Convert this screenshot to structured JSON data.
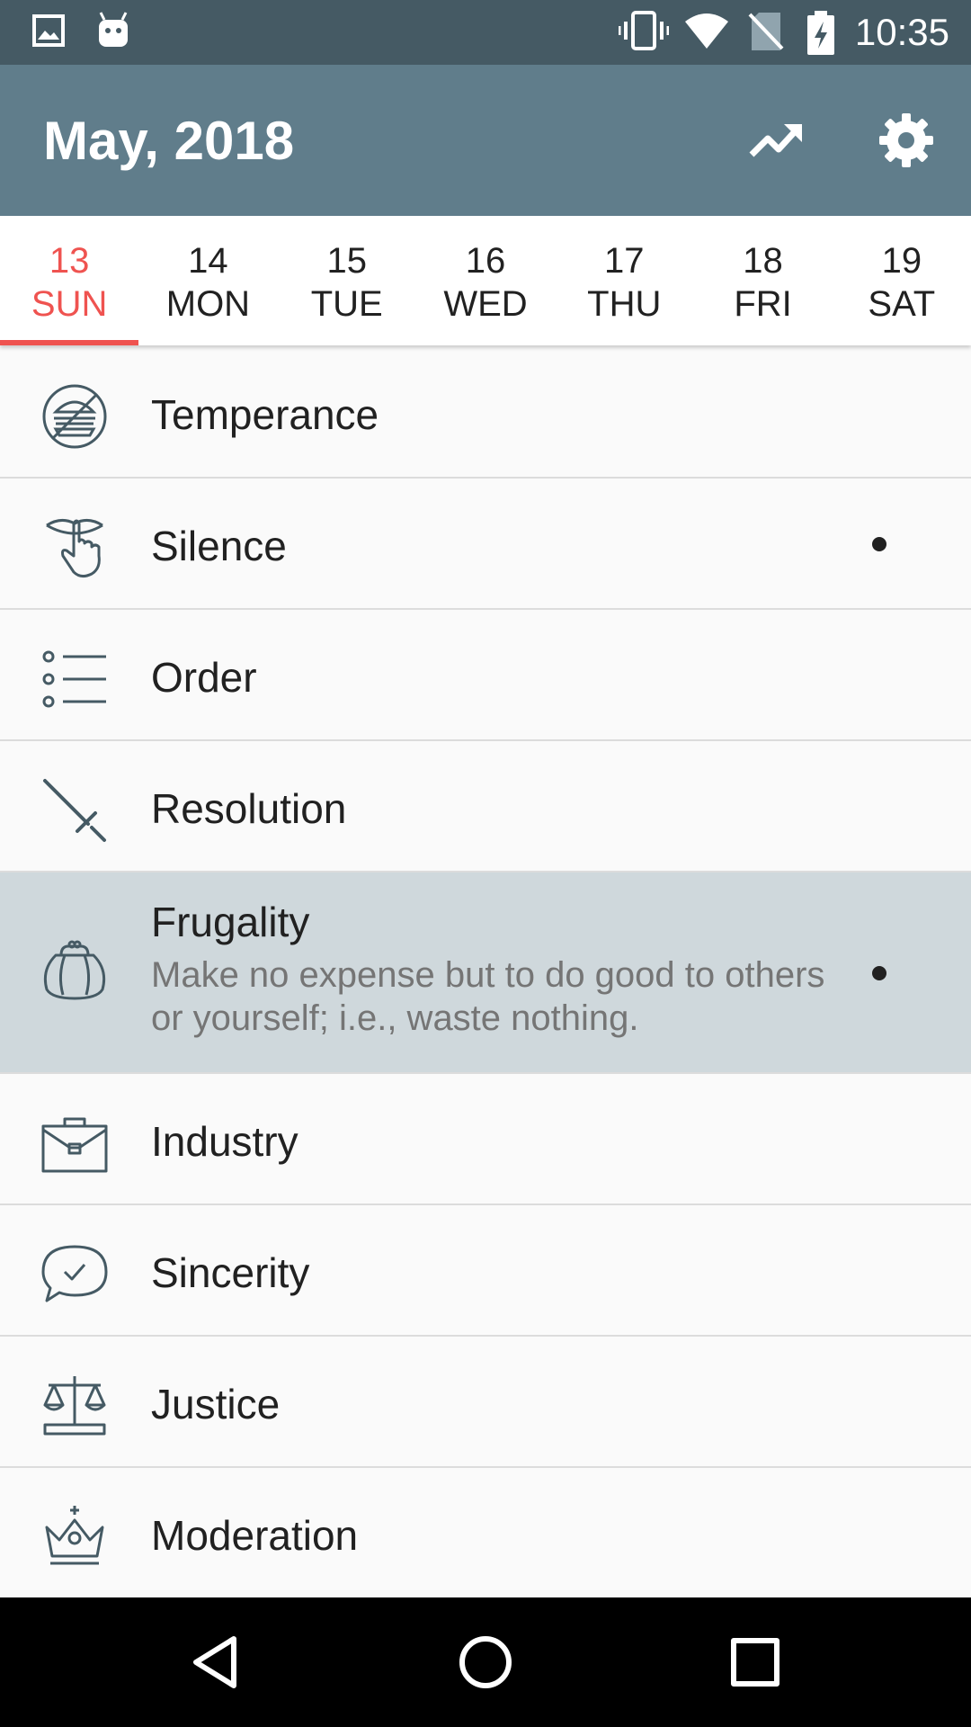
{
  "status_bar": {
    "time": "10:35",
    "icons": [
      "image-icon",
      "android-icon",
      "vibrate-icon",
      "wifi-icon",
      "no-sim-icon",
      "battery-charging-icon"
    ]
  },
  "app_bar": {
    "title": "May, 2018",
    "actions": [
      "trending-up-icon",
      "settings-icon"
    ]
  },
  "week": {
    "days": [
      {
        "date": "13",
        "weekday": "SUN",
        "selected": true
      },
      {
        "date": "14",
        "weekday": "MON",
        "selected": false
      },
      {
        "date": "15",
        "weekday": "TUE",
        "selected": false
      },
      {
        "date": "16",
        "weekday": "WED",
        "selected": false
      },
      {
        "date": "17",
        "weekday": "THU",
        "selected": false
      },
      {
        "date": "18",
        "weekday": "FRI",
        "selected": false
      },
      {
        "date": "19",
        "weekday": "SAT",
        "selected": false
      }
    ]
  },
  "virtues": [
    {
      "title": "Temperance",
      "icon": "no-burger-icon",
      "marked": false
    },
    {
      "title": "Silence",
      "icon": "shush-hand-icon",
      "marked": true
    },
    {
      "title": "Order",
      "icon": "list-icon",
      "marked": false
    },
    {
      "title": "Resolution",
      "icon": "sword-icon",
      "marked": false
    },
    {
      "title": "Frugality",
      "icon": "coin-purse-icon",
      "marked": true,
      "expanded": true,
      "description": "Make no expense but to do good to others or yourself; i.e., waste nothing."
    },
    {
      "title": "Industry",
      "icon": "briefcase-icon",
      "marked": false
    },
    {
      "title": "Sincerity",
      "icon": "speech-check-icon",
      "marked": false
    },
    {
      "title": "Justice",
      "icon": "scales-icon",
      "marked": false
    },
    {
      "title": "Moderation",
      "icon": "crown-icon",
      "marked": false
    }
  ],
  "nav_bar": {
    "buttons": [
      "back-icon",
      "home-icon",
      "recents-icon"
    ]
  },
  "colors": {
    "status_bar": "#455a64",
    "app_bar": "#607d8b",
    "accent": "#ef5350",
    "expanded_row": "#cfd8dc",
    "icon_stroke": "#455a64"
  }
}
